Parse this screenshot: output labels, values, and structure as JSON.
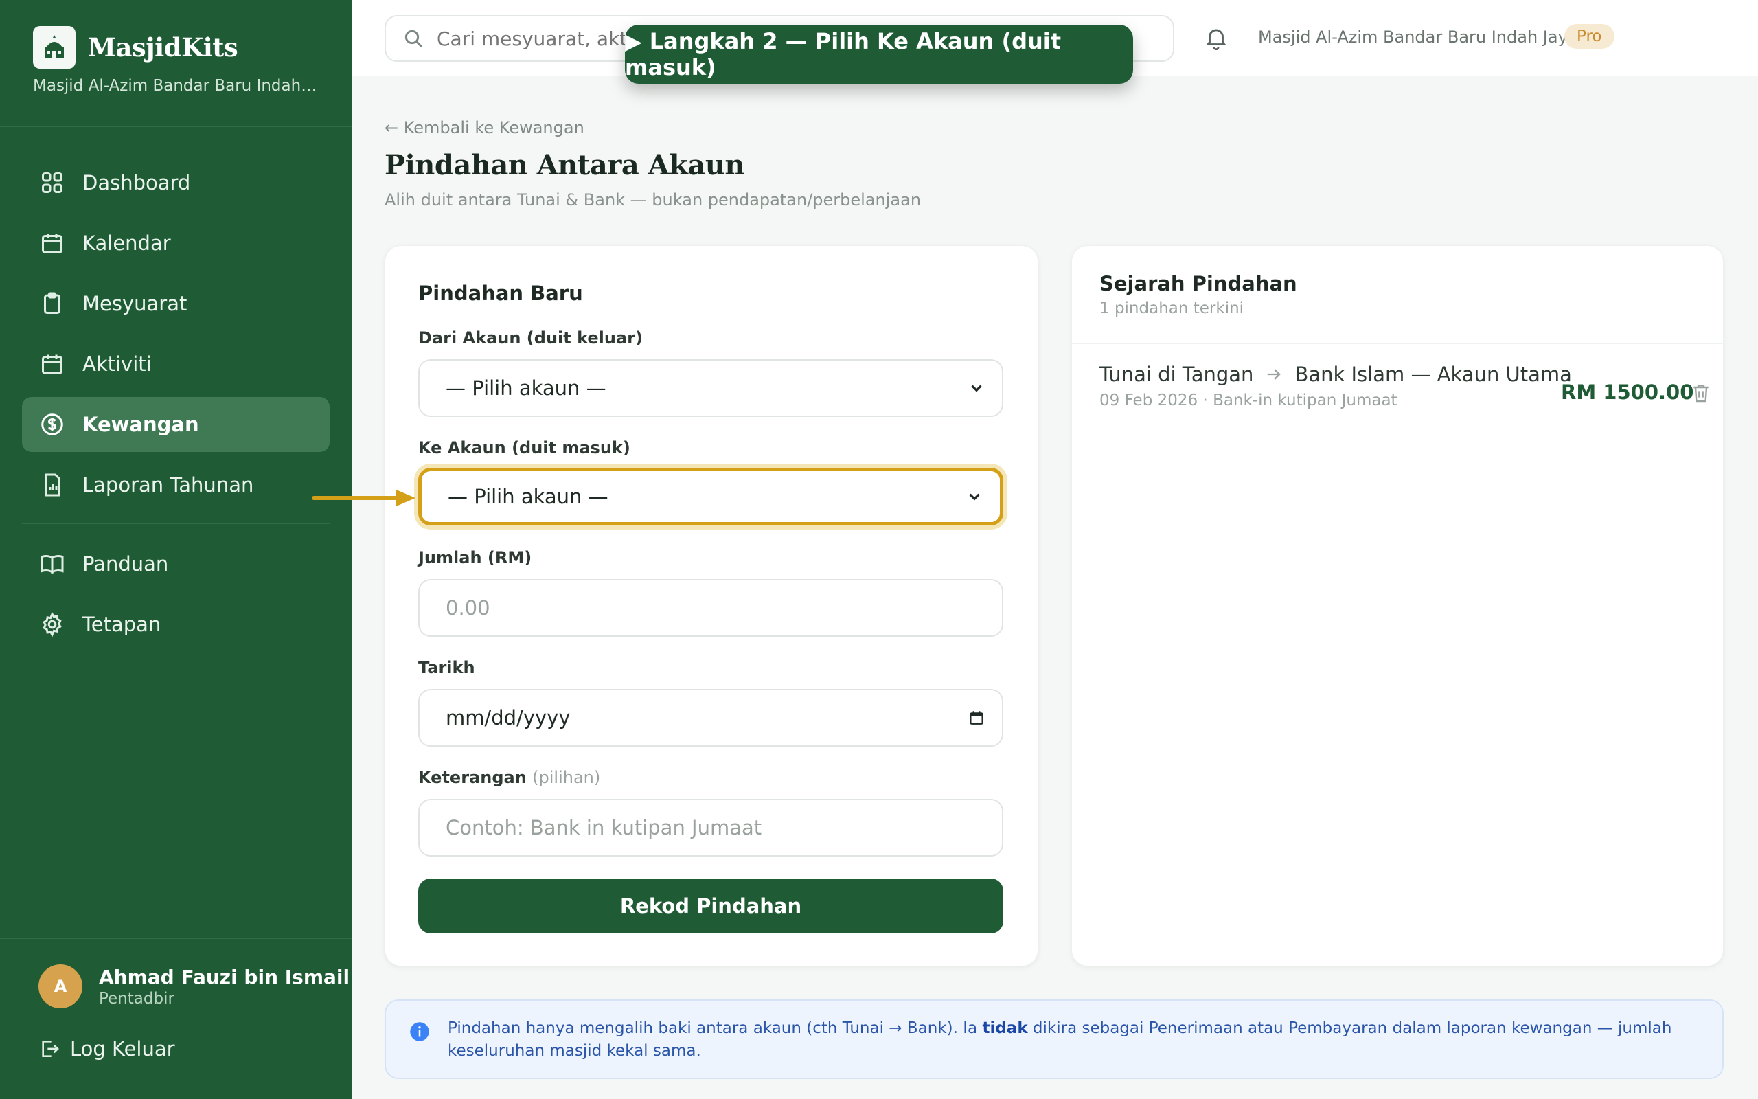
{
  "app": {
    "name": "MasjidKits",
    "mosque_name_short": "Masjid Al-Azim Bandar Baru Indah J..."
  },
  "sidebar": {
    "items": [
      {
        "label": "Dashboard",
        "icon": "grid-icon"
      },
      {
        "label": "Kalendar",
        "icon": "calendar-icon"
      },
      {
        "label": "Mesyuarat",
        "icon": "clipboard-icon"
      },
      {
        "label": "Aktiviti",
        "icon": "calendar-icon"
      },
      {
        "label": "Kewangan",
        "icon": "dollar-icon",
        "active": true
      },
      {
        "label": "Laporan Tahunan",
        "icon": "report-icon"
      },
      {
        "label": "Panduan",
        "icon": "book-icon"
      },
      {
        "label": "Tetapan",
        "icon": "gear-icon"
      }
    ],
    "user": {
      "initial": "A",
      "name": "Ahmad Fauzi bin Ismail",
      "role": "Pentadbir"
    },
    "logout_label": "Log Keluar"
  },
  "topbar": {
    "search_placeholder": "Cari mesyuarat, aktivi",
    "mosque_name": "Masjid Al-Azim Bandar Baru Indah Jaya",
    "plan_badge": "Pro"
  },
  "tutorial": {
    "label": "▶ Langkah 2 — Pilih Ke Akaun (duit masuk)"
  },
  "page": {
    "back_link": "← Kembali ke Kewangan",
    "title": "Pindahan Antara Akaun",
    "subtitle": "Alih duit antara Tunai & Bank — bukan pendapatan/perbelanjaan"
  },
  "form": {
    "title": "Pindahan Baru",
    "from_label": "Dari Akaun (duit keluar)",
    "from_value": "— Pilih akaun —",
    "to_label": "Ke Akaun (duit masuk)",
    "to_value": "— Pilih akaun —",
    "amount_label": "Jumlah (RM)",
    "amount_placeholder": "0.00",
    "date_label": "Tarikh",
    "date_placeholder": "mm/dd/yyyy",
    "note_label": "Keterangan",
    "note_optional": "(pilihan)",
    "note_placeholder": "Contoh: Bank in kutipan Jumaat",
    "submit_label": "Rekod Pindahan"
  },
  "history": {
    "title": "Sejarah Pindahan",
    "count": "1 pindahan terkini",
    "rows": [
      {
        "from": "Tunai di Tangan",
        "to": "Bank Islam — Akaun Utama",
        "meta": "09 Feb 2026 · Bank-in kutipan Jumaat",
        "amount": "RM 1500.00"
      }
    ]
  },
  "info": {
    "text_before": "Pindahan hanya mengalih baki antara akaun (cth Tunai → Bank). Ia ",
    "text_bold": "tidak",
    "text_after": " dikira sebagai Penerimaan atau Pembayaran dalam laporan kewangan — jumlah keseluruhan masjid kekal sama."
  },
  "colors": {
    "brand": "#1f5c35",
    "highlight": "#d4a017",
    "amount": "#1f5c35",
    "info": "#2a55a8"
  }
}
